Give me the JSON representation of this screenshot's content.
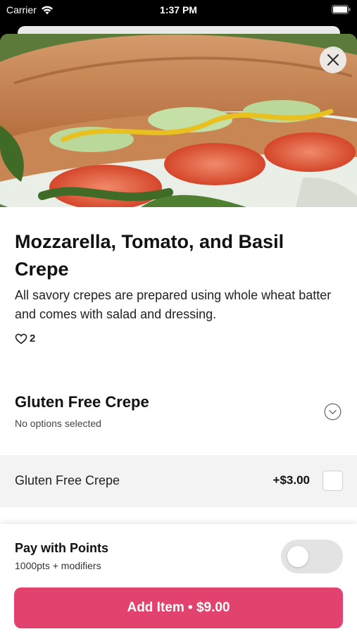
{
  "status_bar": {
    "carrier": "Carrier",
    "time": "1:37 PM"
  },
  "item": {
    "title": "Mozzarella, Tomato, and Basil Crepe",
    "description": "All savory crepes are prepared using whole wheat batter and comes with salad and dressing.",
    "likes_count": "2",
    "image_icon": "crepe-photo"
  },
  "option_group": {
    "title": "Gluten Free Crepe",
    "subtitle": "No options selected",
    "expanded": true,
    "options": [
      {
        "label": "Gluten Free Crepe",
        "price": "+$3.00",
        "checked": false
      }
    ]
  },
  "points": {
    "title": "Pay with Points",
    "subtitle": "1000pts + modifiers",
    "enabled": false
  },
  "add_button": {
    "label": "Add Item • $9.00"
  },
  "colors": {
    "accent": "#e2426e",
    "toggle_off": "#e3e3e3",
    "row_background": "#f3f3f3"
  }
}
